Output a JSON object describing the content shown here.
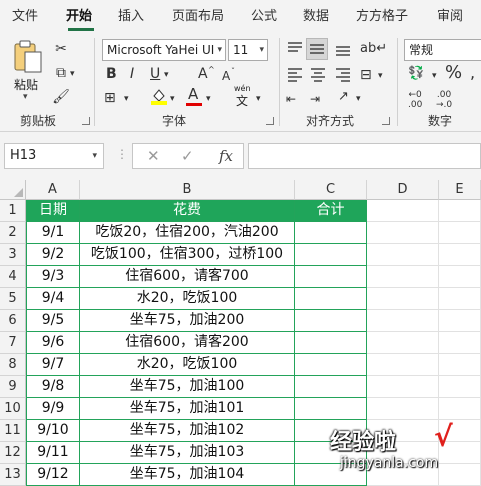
{
  "tabs": [
    "文件",
    "开始",
    "插入",
    "页面布局",
    "公式",
    "数据",
    "方方格子",
    "审阅"
  ],
  "active_tab": "开始",
  "ribbon": {
    "clipboard": {
      "paste_label": "粘贴",
      "group_label": "剪贴板"
    },
    "font": {
      "font_name": "Microsoft YaHei UI",
      "font_size": "11",
      "bold": "B",
      "italic": "I",
      "underline": "U",
      "grow": "A",
      "shrink": "A",
      "pinyin": "wén",
      "group_label": "字体"
    },
    "alignment": {
      "group_label": "对齐方式"
    },
    "number": {
      "format": "常规",
      "percent": "%",
      "group_label": "数字"
    }
  },
  "formula_bar": {
    "name_box": "H13",
    "cancel": "✕",
    "confirm": "✓",
    "fx": "fx",
    "formula": ""
  },
  "columns": [
    "A",
    "B",
    "C",
    "D",
    "E"
  ],
  "rows": [
    "1",
    "2",
    "3",
    "4",
    "5",
    "6",
    "7",
    "8",
    "9",
    "10",
    "11",
    "12",
    "13"
  ],
  "table": {
    "headers": [
      "日期",
      "花费",
      "合计"
    ],
    "data": [
      [
        "9/1",
        "吃饭20，住宿200，汽油200",
        ""
      ],
      [
        "9/2",
        "吃饭100，住宿300，过桥100",
        ""
      ],
      [
        "9/3",
        "住宿600，请客700",
        ""
      ],
      [
        "9/4",
        "水20，吃饭100",
        ""
      ],
      [
        "9/5",
        "坐车75，加油200",
        ""
      ],
      [
        "9/6",
        "住宿600，请客200",
        ""
      ],
      [
        "9/7",
        "水20，吃饭100",
        ""
      ],
      [
        "9/8",
        "坐车75，加油100",
        ""
      ],
      [
        "9/9",
        "坐车75，加油101",
        ""
      ],
      [
        "9/10",
        "坐车75，加油102",
        ""
      ],
      [
        "9/11",
        "坐车75，加油103",
        ""
      ],
      [
        "9/12",
        "坐车75，加油104",
        ""
      ]
    ]
  },
  "colors": {
    "accent": "#217346",
    "table_header": "#1fa55a",
    "table_border": "#23a35a"
  },
  "watermark": {
    "text": "经验啦",
    "url": "jingyanla.com"
  }
}
